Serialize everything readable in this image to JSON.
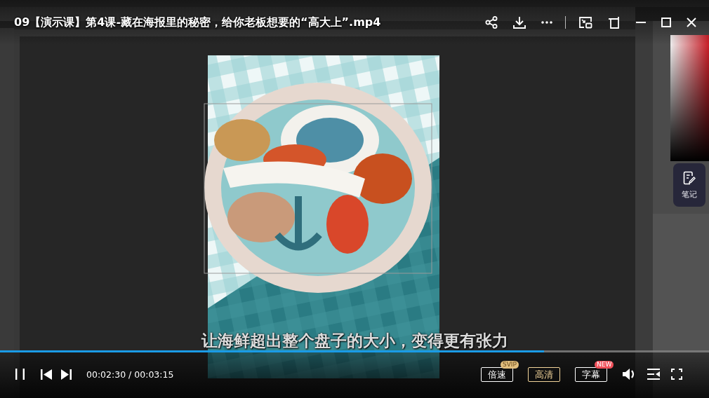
{
  "window": {
    "title": "09【演示课】第4课-藏在海报里的秘密，给你老板想要的“高大上”.mp4"
  },
  "video": {
    "subtitle": "让海鲜超出整个盘子的大小，变得更有张力"
  },
  "note_button": {
    "label": "笔记"
  },
  "playback": {
    "playing": true,
    "progress": {
      "level": 0.767
    },
    "time": "00:02:30 / 00:03:15"
  },
  "buttons": [
    {
      "label": "倍速",
      "selected": false,
      "badge": {
        "text": "SVIP",
        "kind": "svip"
      }
    },
    {
      "label": "高清",
      "selected": true
    },
    {
      "label": "字幕",
      "selected": false,
      "badge": {
        "text": "NEW",
        "kind": "new"
      }
    }
  ]
}
